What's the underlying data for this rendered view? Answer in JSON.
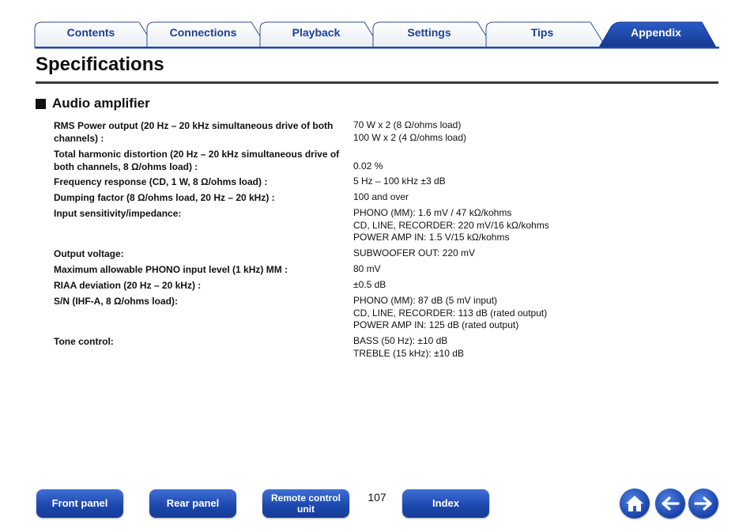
{
  "tabs": [
    {
      "label": "Contents",
      "active": false
    },
    {
      "label": "Connections",
      "active": false
    },
    {
      "label": "Playback",
      "active": false
    },
    {
      "label": "Settings",
      "active": false
    },
    {
      "label": "Tips",
      "active": false
    },
    {
      "label": "Appendix",
      "active": true
    }
  ],
  "page_title": "Specifications",
  "section": {
    "heading": "Audio amplifier",
    "specs": [
      {
        "label": "RMS Power output (20 Hz – 20 kHz simultaneous drive of both channels) :",
        "values": [
          "70 W x 2 (8 Ω/ohms load)",
          "100 W x 2 (4 Ω/ohms load)"
        ]
      },
      {
        "label": "Total harmonic distortion (20 Hz – 20 kHz simultaneous drive of both channels, 8 Ω/ohms load) :",
        "values": [
          "0.02 %"
        ]
      },
      {
        "label": "Frequency response (CD, 1 W, 8 Ω/ohms load) :",
        "values": [
          "5 Hz – 100 kHz ±3 dB"
        ]
      },
      {
        "label": "Dumping factor (8 Ω/ohms load, 20 Hz – 20 kHz) :",
        "values": [
          "100 and over"
        ]
      },
      {
        "label": "Input sensitivity/impedance:",
        "values": [
          "PHONO (MM): 1.6 mV / 47 kΩ/kohms",
          "CD, LINE, RECORDER: 220 mV/16 kΩ/kohms",
          "POWER AMP IN: 1.5 V/15 kΩ/kohms"
        ]
      },
      {
        "label": "Output voltage:",
        "values": [
          "SUBWOOFER OUT: 220 mV"
        ]
      },
      {
        "label": "Maximum allowable PHONO input level (1 kHz) MM :",
        "values": [
          "80 mV"
        ]
      },
      {
        "label": "RIAA deviation (20 Hz – 20 kHz) :",
        "values": [
          "±0.5 dB"
        ]
      },
      {
        "label": "S/N (IHF-A, 8 Ω/ohms load):",
        "values": [
          "PHONO (MM): 87 dB (5 mV input)",
          "CD, LINE, RECORDER: 113 dB (rated output)",
          "POWER AMP IN: 125 dB (rated output)"
        ]
      },
      {
        "label": "Tone control:",
        "values": [
          "BASS (50 Hz): ±10 dB",
          "TREBLE (15 kHz): ±10 dB"
        ]
      }
    ]
  },
  "footer": {
    "front_panel": "Front panel",
    "rear_panel": "Rear panel",
    "remote_control_line1": "Remote control",
    "remote_control_line2": "unit",
    "page_number": "107",
    "index": "Index",
    "home_icon": "home-icon",
    "back_icon": "arrow-left-icon",
    "forward_icon": "arrow-right-icon"
  },
  "colors": {
    "tab_text": "#1d3f8f",
    "active_tab_fill": "#1b46ac",
    "button_blue": "#1b46ac",
    "rule": "#3a3a3a"
  }
}
